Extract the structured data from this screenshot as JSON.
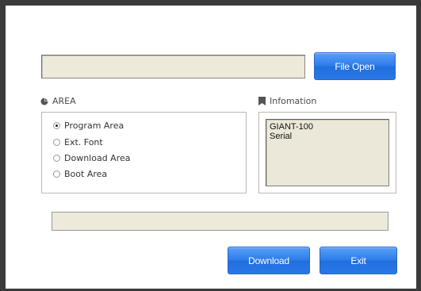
{
  "file": {
    "path_value": "",
    "open_button_label": "File Open"
  },
  "area": {
    "title": "AREA",
    "options": [
      {
        "label": "Program Area",
        "checked": true
      },
      {
        "label": "Ext. Font",
        "checked": false
      },
      {
        "label": "Download Area",
        "checked": false
      },
      {
        "label": "Boot Area",
        "checked": false
      }
    ]
  },
  "info": {
    "title": "Infomation",
    "lines": [
      "GIANT-100",
      "Serial"
    ]
  },
  "status": {
    "text": ""
  },
  "actions": {
    "download_label": "Download",
    "exit_label": "Exit"
  },
  "colors": {
    "button_blue": "#2d7ce9",
    "field_bg": "#ede9db",
    "frame": "#3a3a3a"
  },
  "icons": {
    "area": "pie-chart-icon",
    "info": "bookmark-icon"
  }
}
